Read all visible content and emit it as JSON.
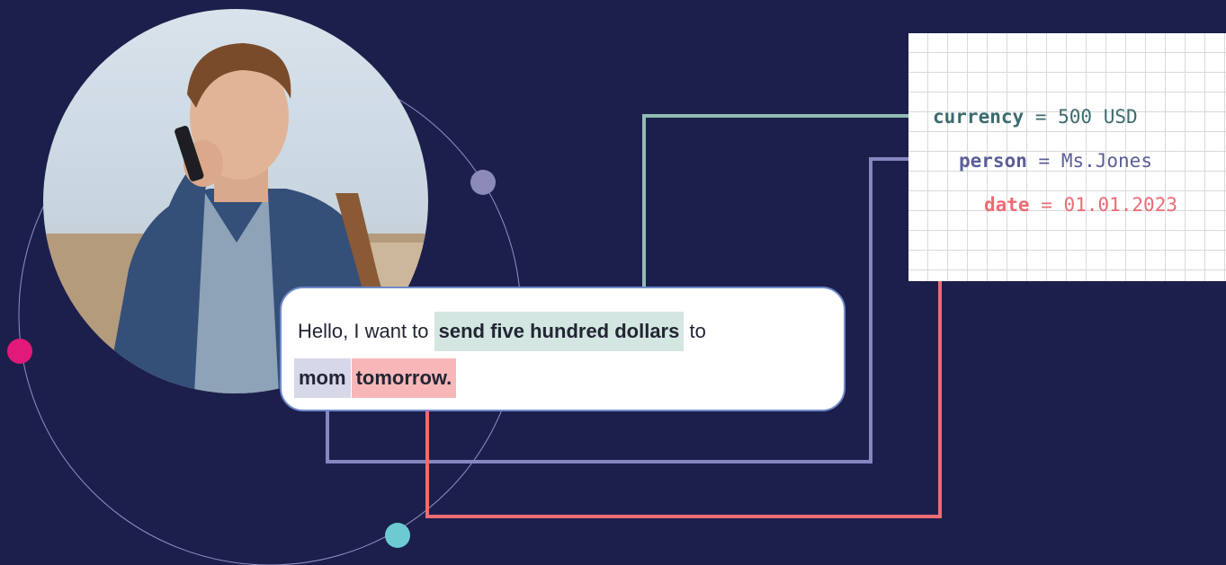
{
  "message": {
    "prefix": "Hello, I want to",
    "amount_phrase": "send five hundred dollars",
    "connector": "to",
    "person_phrase": "mom",
    "date_phrase": "tomorrow."
  },
  "entities": {
    "currency": {
      "key": "currency",
      "equals": "=",
      "value": "500 USD"
    },
    "person": {
      "key": "person",
      "equals": "=",
      "value": "Ms.Jones"
    },
    "date": {
      "key": "date",
      "equals": "=",
      "value": "01.01.2023"
    }
  },
  "colors": {
    "background": "#1c1f4b",
    "currency": "#3b6b6f",
    "currency_connector": "#8fbcb4",
    "person": "#5b5e96",
    "person_connector": "#8487c0",
    "date": "#ec6b74",
    "dot_magenta": "#e3197a",
    "dot_teal": "#6ccbd0",
    "dot_lavender": "#8b8ab8"
  },
  "photo": {
    "subject": "man in blue blazer talking on a smartphone"
  }
}
